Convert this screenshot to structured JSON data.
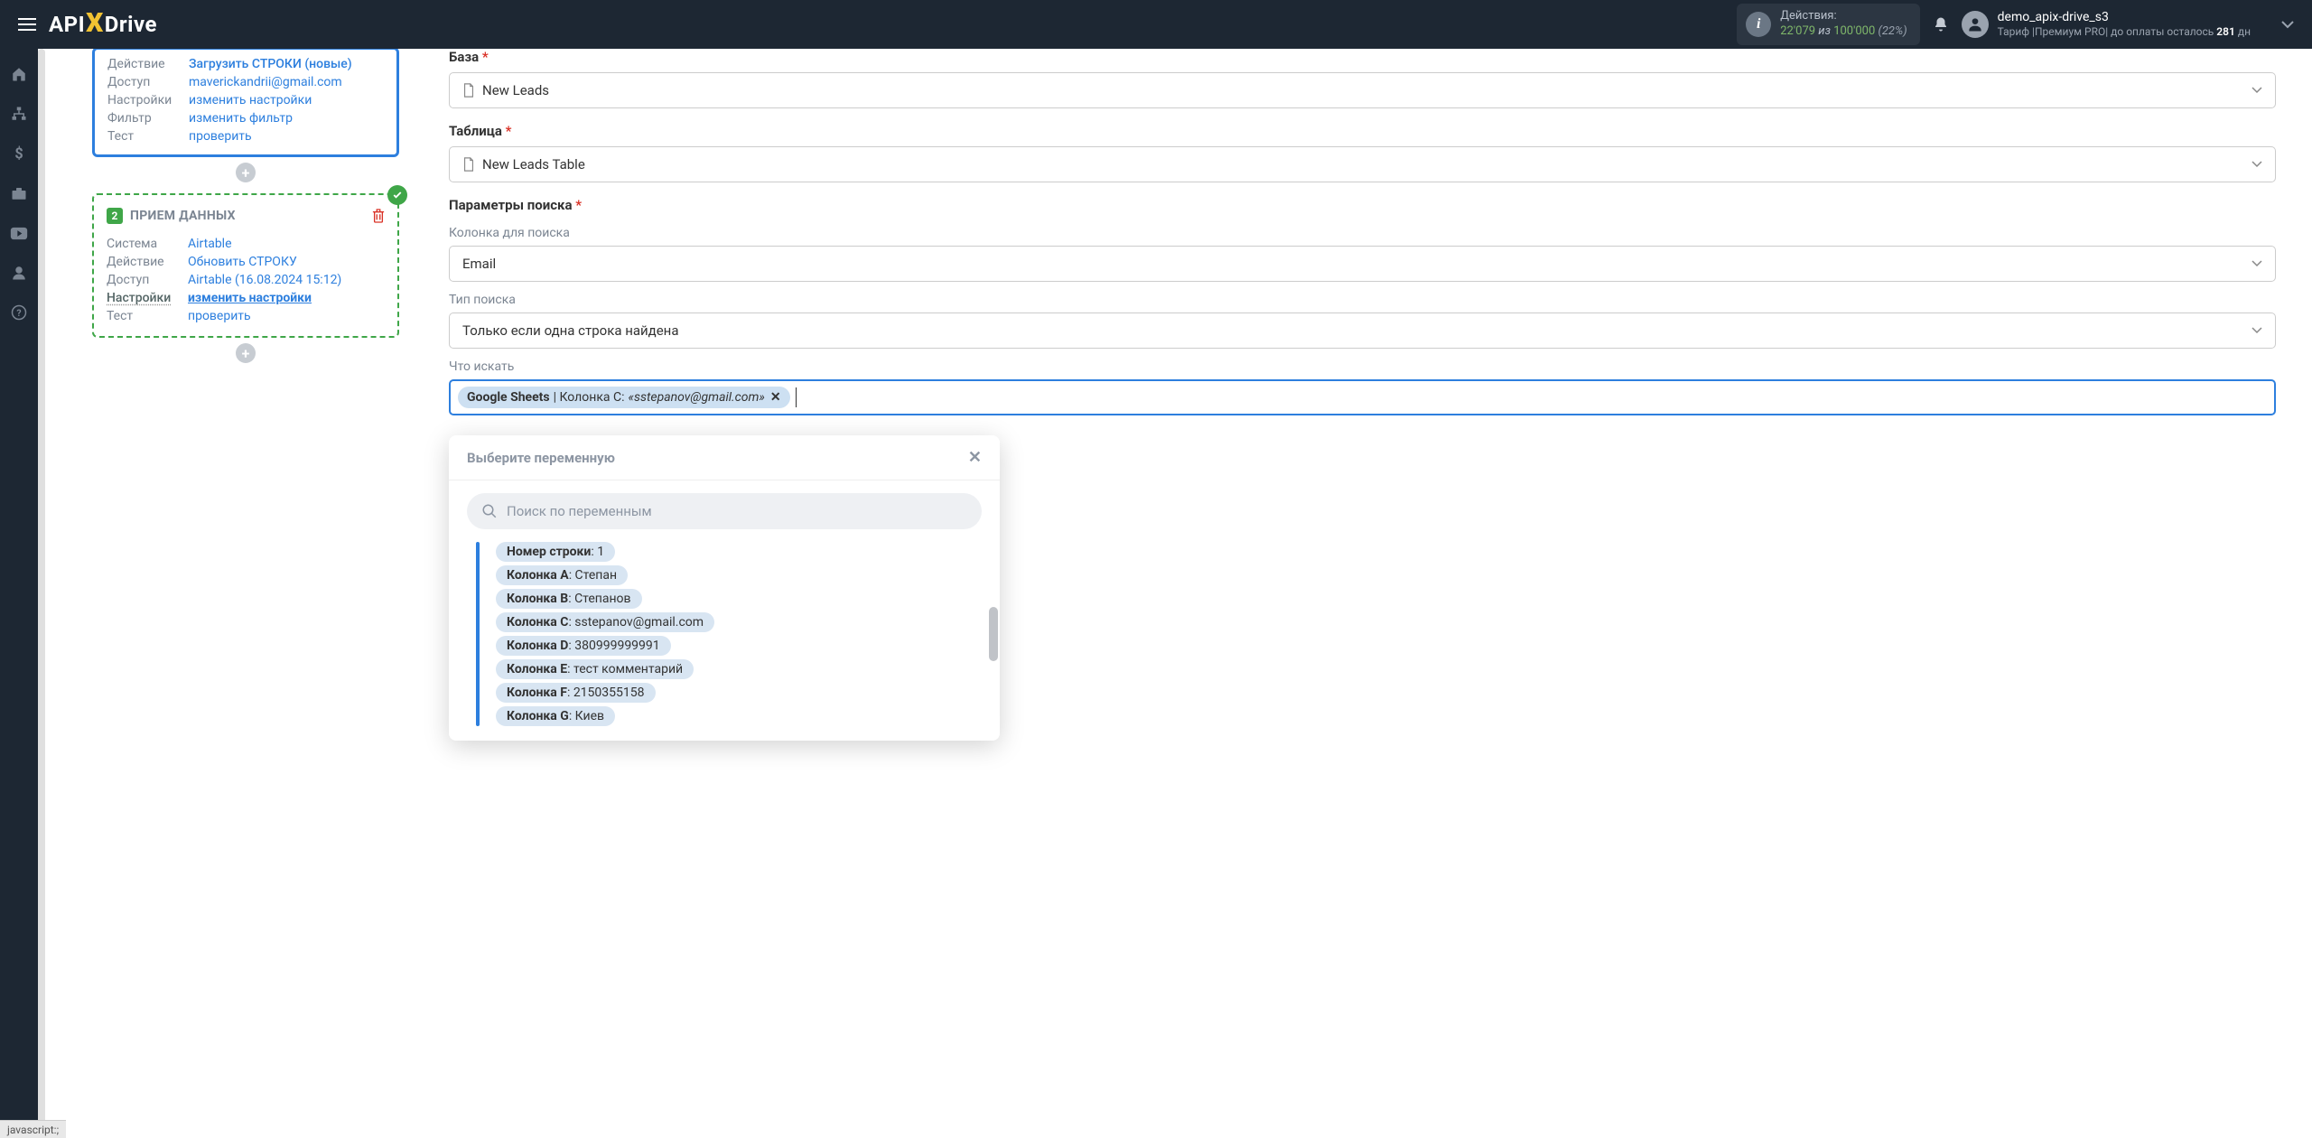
{
  "topbar": {
    "logo_prefix": "API",
    "logo_suffix": "Drive",
    "actions_label": "Действия:",
    "actions_used": "22'079",
    "actions_of": "из",
    "actions_total": "100'000",
    "actions_pct": "(22%)",
    "username": "demo_apix-drive_s3",
    "tariff_prefix": "Тариф |Премиум PRO| до оплаты осталось ",
    "tariff_days": "281",
    "tariff_suffix": " дн"
  },
  "card1": {
    "rows": {
      "action_label": "Действие",
      "action_value": "Загрузить СТРОКИ (новые)",
      "access_label": "Доступ",
      "access_value": "maverickandrii@gmail.com",
      "settings_label": "Настройки",
      "settings_value": "изменить настройки",
      "filter_label": "Фильтр",
      "filter_value": "изменить фильтр",
      "test_label": "Тест",
      "test_value": "проверить"
    }
  },
  "card2": {
    "number": "2",
    "title": "ПРИЕМ ДАННЫХ",
    "rows": {
      "system_label": "Система",
      "system_value": "Airtable",
      "action_label": "Действие",
      "action_value": "Обновить СТРОКУ",
      "access_label": "Доступ",
      "access_value": "Airtable (16.08.2024 15:12)",
      "settings_label": "Настройки",
      "settings_value": "изменить настройки",
      "test_label": "Тест",
      "test_value": "проверить"
    }
  },
  "form": {
    "base_label": "База",
    "base_value": "New Leads",
    "table_label": "Таблица",
    "table_value": "New Leads Table",
    "search_params_label": "Параметры поиска",
    "search_column_label": "Колонка для поиска",
    "search_column_value": "Email",
    "search_type_label": "Тип поиска",
    "search_type_value": "Только если одна строка найдена",
    "search_what_label": "Что искать",
    "tag_source": "Google Sheets",
    "tag_sep": " | Колонка C: ",
    "tag_example": "«sstepanov@gmail.com» "
  },
  "popup": {
    "title": "Выберите переменную",
    "search_placeholder": "Поиск по переменным",
    "items": [
      {
        "key": "Номер строки",
        "val": ": 1"
      },
      {
        "key": "Колонка A",
        "val": ": Степан"
      },
      {
        "key": "Колонка B",
        "val": ": Степанов"
      },
      {
        "key": "Колонка C",
        "val": ": sstepanov@gmail.com"
      },
      {
        "key": "Колонка D",
        "val": ": 380999999991"
      },
      {
        "key": "Колонка E",
        "val": ": тест комментарий"
      },
      {
        "key": "Колонка F",
        "val": ": 2150355158"
      },
      {
        "key": "Колонка G",
        "val": ": Киев"
      }
    ]
  },
  "statusbar": "java​script:;"
}
